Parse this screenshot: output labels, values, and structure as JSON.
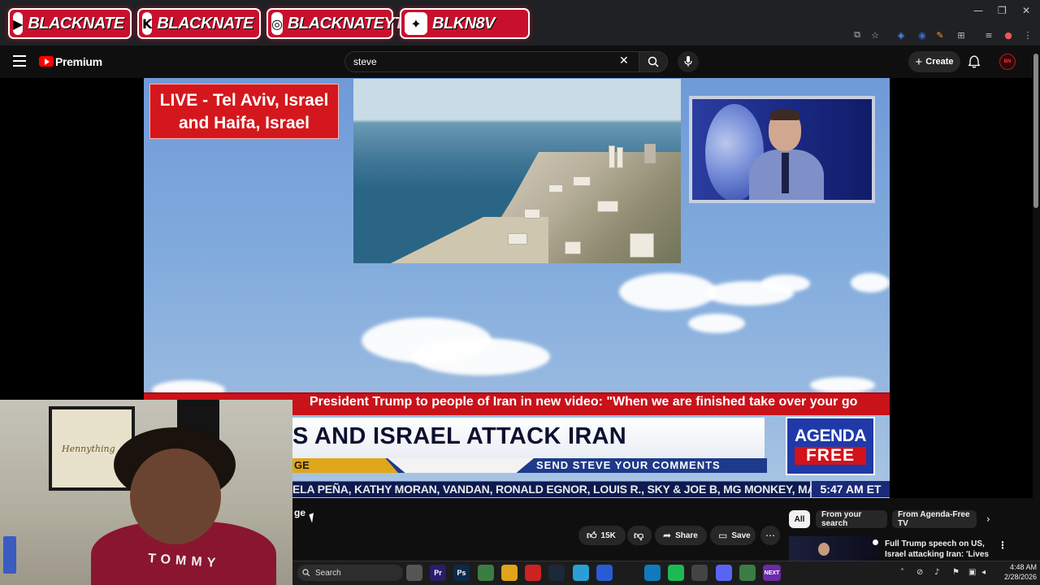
{
  "stream_overlay": {
    "socials": [
      {
        "icon": "youtube-icon",
        "label": "BLACKNATE"
      },
      {
        "icon": "kick-icon",
        "label": "BLACKNATE"
      },
      {
        "icon": "instagram-icon",
        "label": "BLACKNATEYT"
      },
      {
        "icon": "twitter-icon",
        "label": "BLKN8V"
      }
    ],
    "accent_color": "#c8102e"
  },
  "window": {
    "minimize": "—",
    "restore": "❐",
    "close": "✕"
  },
  "header": {
    "logo_text": "Premium",
    "search_value": "steve",
    "create_label": "Create"
  },
  "video": {
    "live_line1": "LIVE - Tel Aviv, Israel",
    "live_line2": "and Haifa, Israel",
    "ticker": "President Trump to people of Iran in new video: \"When we are finished take over your go",
    "headline": "S AND ISRAEL ATTACK IRAN",
    "sub_left": "GE",
    "sub_right": "SEND STEVE YOUR COMMENTS",
    "names": "ELA PEÑA, KATHY MORAN, VANDAN, RONALD EGNOR, LOUIS R., SKY & JOE B, MG MONKEY, MARGAR",
    "time": "5:47 AM ET",
    "logo_line1": "AGENDA",
    "logo_line2": "FREE"
  },
  "facecam": {
    "poster_text": "Hennything",
    "hoodie_text": "TOMMY"
  },
  "below_video": {
    "partial_title": "ge",
    "like_count": "15K",
    "share_label": "Share",
    "save_label": "Save"
  },
  "chips": [
    "All",
    "From your search",
    "From Agenda-Free TV"
  ],
  "recommendation": {
    "title": "Full Trump speech on US, Israel attacking Iran: 'Lives of ..."
  },
  "taskbar": {
    "search_label": "Search",
    "time": "4:48 AM",
    "date": "2/28/2026",
    "apps": [
      {
        "icon": "task-view-icon",
        "color": "#555"
      },
      {
        "icon": "premiere-icon",
        "color": "#2a1d6b"
      },
      {
        "icon": "photoshop-icon",
        "color": "#0b2a4a"
      },
      {
        "icon": "chrome-icon",
        "color": "#3a7d44"
      },
      {
        "icon": "file-explorer-icon",
        "color": "#e0a41a"
      },
      {
        "icon": "app-red-icon",
        "color": "#c22"
      },
      {
        "icon": "steam-icon",
        "color": "#1b2838"
      },
      {
        "icon": "telegram-icon",
        "color": "#2a9fd6"
      },
      {
        "icon": "app-blue-icon",
        "color": "#2a5bd6"
      },
      {
        "icon": "edge-icon",
        "color": "#0f7bbd"
      },
      {
        "icon": "spotify-icon",
        "color": "#1db954"
      },
      {
        "icon": "settings-icon",
        "color": "#444"
      },
      {
        "icon": "discord-icon",
        "color": "#5865f2"
      },
      {
        "icon": "chrome-icon",
        "color": "#3a7d44"
      },
      {
        "icon": "next-app-icon",
        "color": "#6b2aa8"
      }
    ],
    "next_label": "NEXT"
  }
}
